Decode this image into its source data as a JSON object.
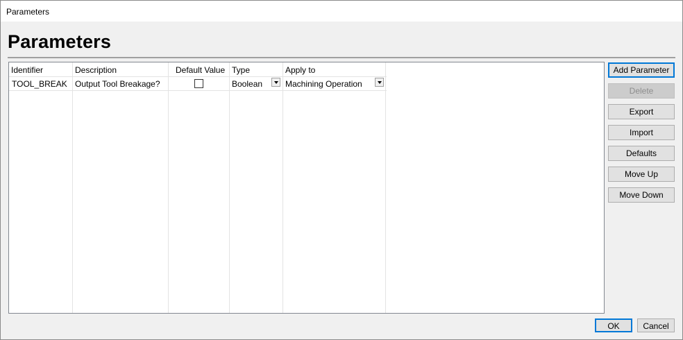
{
  "window": {
    "title": "Parameters"
  },
  "page": {
    "heading": "Parameters"
  },
  "grid": {
    "columns": [
      "Identifier",
      "Description",
      "Default Value",
      "Type",
      "Apply to"
    ],
    "rows": [
      {
        "identifier": "TOOL_BREAK",
        "description": "Output Tool Breakage?",
        "default_value": false,
        "type": "Boolean",
        "apply_to": "Machining Operation"
      }
    ]
  },
  "buttons": {
    "add": "Add Parameter",
    "delete": "Delete",
    "export": "Export",
    "import": "Import",
    "defaults": "Defaults",
    "move_up": "Move Up",
    "move_down": "Move Down",
    "ok": "OK",
    "cancel": "Cancel"
  },
  "colors": {
    "focus_border": "#0078d7"
  }
}
